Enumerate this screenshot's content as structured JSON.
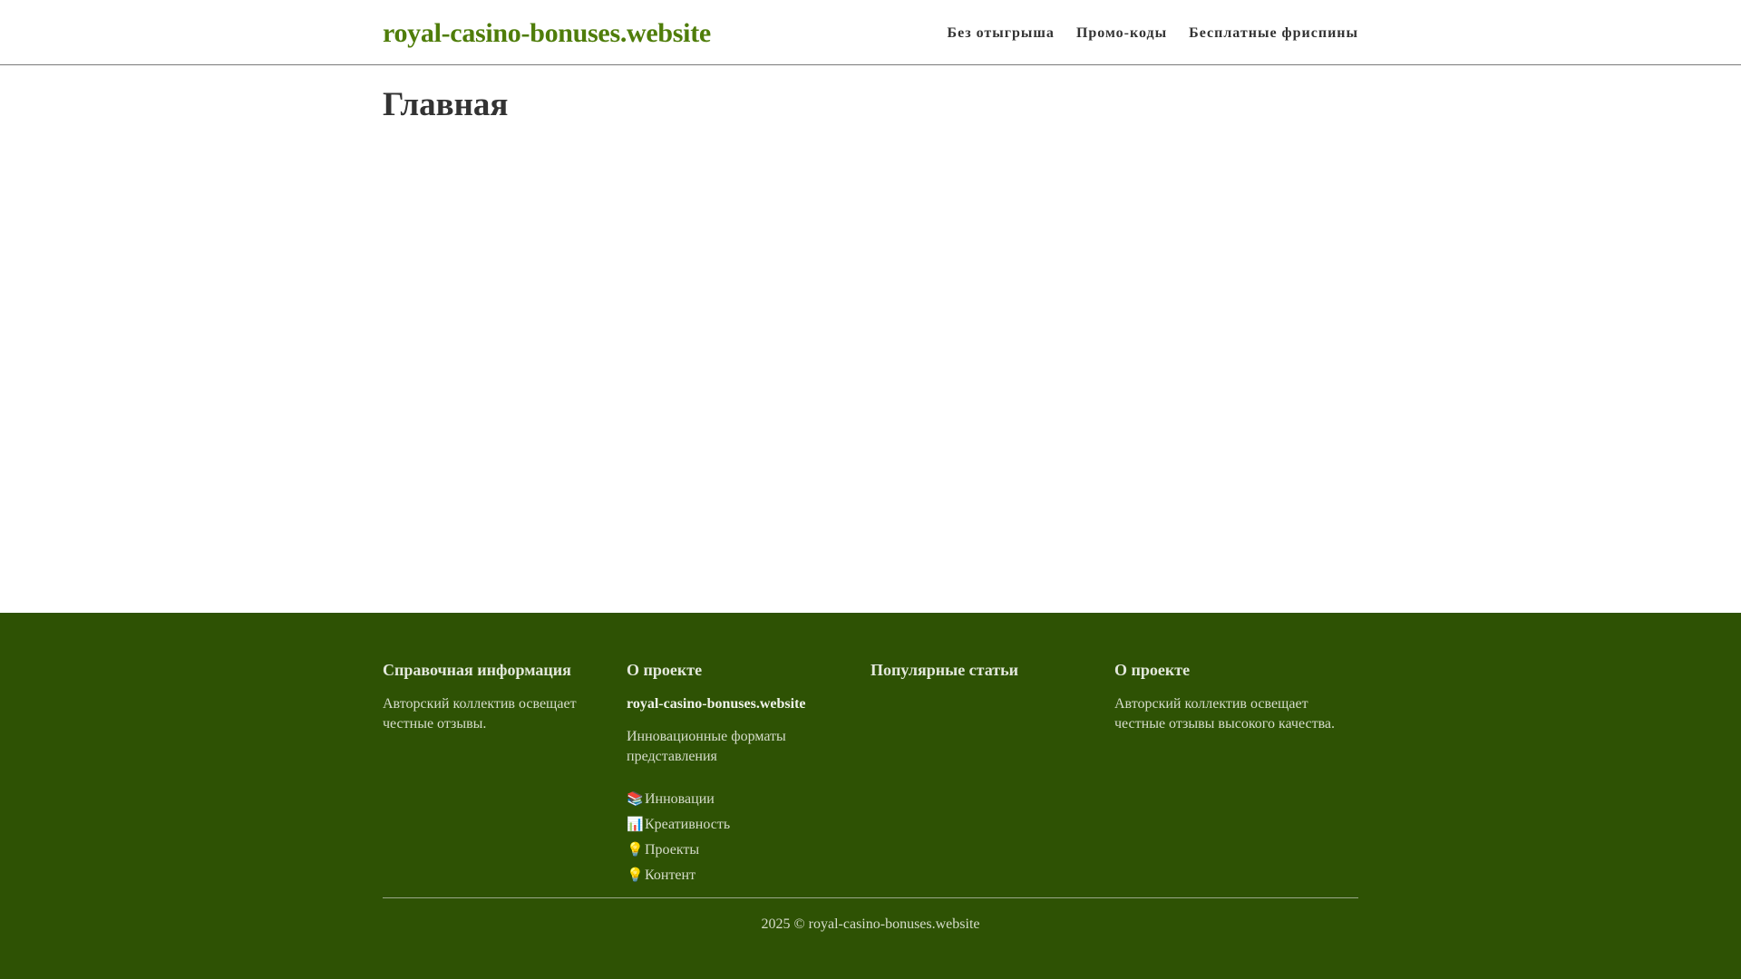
{
  "header": {
    "site_title": "royal-casino-bonuses.website",
    "nav": [
      {
        "label": "Без отыгрыша"
      },
      {
        "label": "Промо-коды"
      },
      {
        "label": "Бесплатные фриспины"
      }
    ]
  },
  "main": {
    "title": "Главная"
  },
  "footer": {
    "col1": {
      "heading": "Справочная информация",
      "text": "Авторский коллектив освещает честные отзывы."
    },
    "col2": {
      "heading": "О проекте",
      "brand": "royal-casino-bonuses.website",
      "text": "Инновационные форматы представления",
      "links": [
        {
          "icon": "📚",
          "icon_name": "books-icon",
          "label": "Инновации"
        },
        {
          "icon": "📊",
          "icon_name": "bar-chart-icon",
          "label": "Креативность"
        },
        {
          "icon": "💡",
          "icon_name": "light-bulb-icon",
          "label": "Проекты"
        },
        {
          "icon": "💡",
          "icon_name": "light-bulb-icon",
          "label": "Контент"
        }
      ]
    },
    "col3": {
      "heading": "Популярные статьи"
    },
    "col4": {
      "heading": "О проекте",
      "text": "Авторский коллектив освещает честные отзывы высокого качества."
    },
    "copyright": "2025 © royal-casino-bonuses.website"
  },
  "colors": {
    "brand_green": "#4f7d0a",
    "footer_bg": "#2e5204"
  }
}
